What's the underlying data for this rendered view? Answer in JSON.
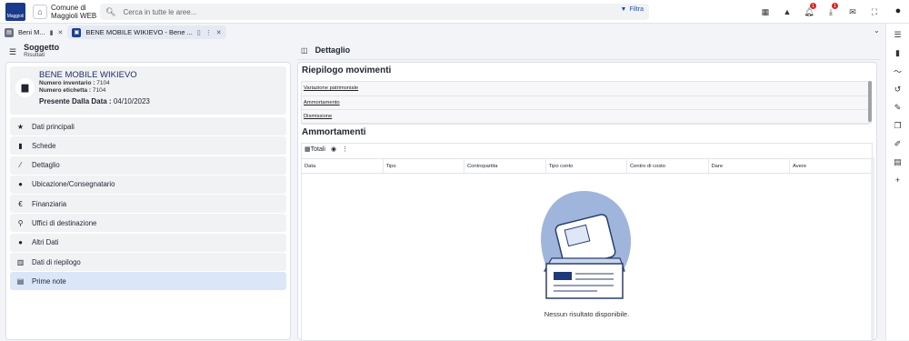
{
  "header": {
    "logo_text": "Maggioli",
    "org_line1": "Comune di",
    "org_line2": "Maggioli WEB",
    "search_placeholder": "Cerca in tutte le aree...",
    "filter_label": "Filtra",
    "notification_count": "1",
    "download_count": "1"
  },
  "tabs": [
    {
      "label": "Beni M..."
    },
    {
      "label": "BENE MOBILE WIKIEVO - Bene ..."
    }
  ],
  "left": {
    "section_title": "Soggetto",
    "section_subtitle": "Risultati",
    "bene": {
      "title": "BENE MOBILE WIKIEVO",
      "inventory_label": "Numero inventario :",
      "inventory_value": "7104",
      "label_label": "Numero etichetta :",
      "label_value": "7104",
      "present_label": "Presente Dalla Data :",
      "present_value": "04/10/2023"
    },
    "menu": [
      {
        "label": "Dati principali",
        "icon": "star-icon"
      },
      {
        "label": "Schede",
        "icon": "document-icon"
      },
      {
        "label": "Dettaglio",
        "icon": "magic-wand-icon"
      },
      {
        "label": "Ubicazione/Consegnatario",
        "icon": "person-icon"
      },
      {
        "label": "Finanziaria",
        "icon": "euro-icon"
      },
      {
        "label": "Uffici di destinazione",
        "icon": "location-pin-icon"
      },
      {
        "label": "Altri Dati",
        "icon": "info-icon"
      },
      {
        "label": "Dati di riepilogo",
        "icon": "calculator-icon"
      },
      {
        "label": "Prime note",
        "icon": "ledger-icon"
      }
    ]
  },
  "right": {
    "header_title": "Dettaglio",
    "movimenti_title": "Riepilogo movimenti",
    "movimenti": [
      "Variazione patrimoniale",
      "Ammortamento",
      "Dismissione"
    ],
    "ammortamenti_title": "Ammortamenti",
    "toolbar_totali": "Totali",
    "columns": [
      "Data",
      "Tipo",
      "Contropartita",
      "Tipo conto",
      "Centro di costo",
      "Dare",
      "Avere"
    ],
    "empty_message": "Nessun risultato disponibile."
  },
  "colors": {
    "brand": "#1b3a8c",
    "selected_menu": "#dbe7f8",
    "badge": "#d92525"
  }
}
